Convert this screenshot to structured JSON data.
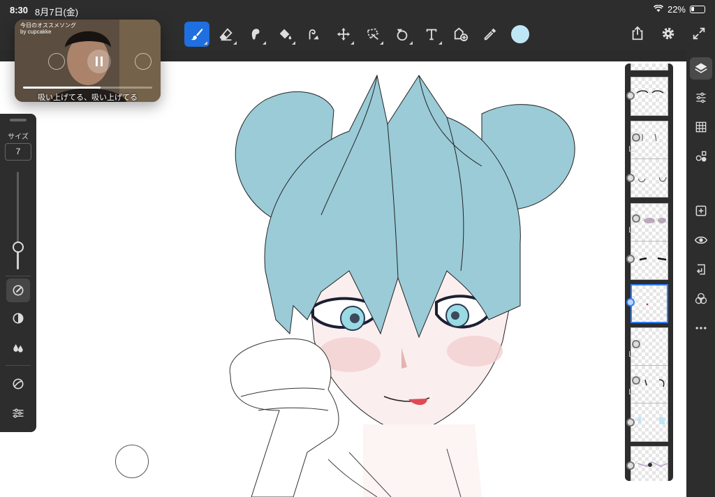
{
  "status": {
    "time": "8:30",
    "date": "8月7日(金)",
    "battery": "22%"
  },
  "toolbar": {
    "tools": [
      {
        "name": "brush-tool",
        "icon": "brush-icon",
        "active": true
      },
      {
        "name": "eraser-tool",
        "icon": "eraser-icon",
        "active": false
      },
      {
        "name": "smudge-tool",
        "icon": "smudge-icon",
        "active": false
      },
      {
        "name": "fill-tool",
        "icon": "bucket-icon",
        "active": false
      },
      {
        "name": "liquify-tool",
        "icon": "liquify-icon",
        "active": false
      },
      {
        "name": "move-tool",
        "icon": "move-icon",
        "active": false
      },
      {
        "name": "lasso-tool",
        "icon": "lasso-icon",
        "active": false
      },
      {
        "name": "shape-tool",
        "icon": "shape-icon",
        "active": false
      },
      {
        "name": "text-tool",
        "icon": "text-icon",
        "active": false
      },
      {
        "name": "image-tool",
        "icon": "image-icon",
        "active": false
      },
      {
        "name": "eyedropper-tool",
        "icon": "eyedropper-icon",
        "active": false
      }
    ],
    "current_color": "#bfe6f5"
  },
  "left_panel": {
    "size_label": "サイズ",
    "size_value": "7",
    "size_slider_fraction": 0.23
  },
  "pip": {
    "title": "今日のオススメソング",
    "subtitle": "by cupcakke",
    "caption": "吸い上げてる、吸い上げてる",
    "progress_fraction": 0.6
  },
  "layers": {
    "selected_index": 5
  },
  "colors": {
    "hair": "#9acbd7",
    "accent": "#1f6fe0",
    "panel": "#2d2d2d"
  }
}
